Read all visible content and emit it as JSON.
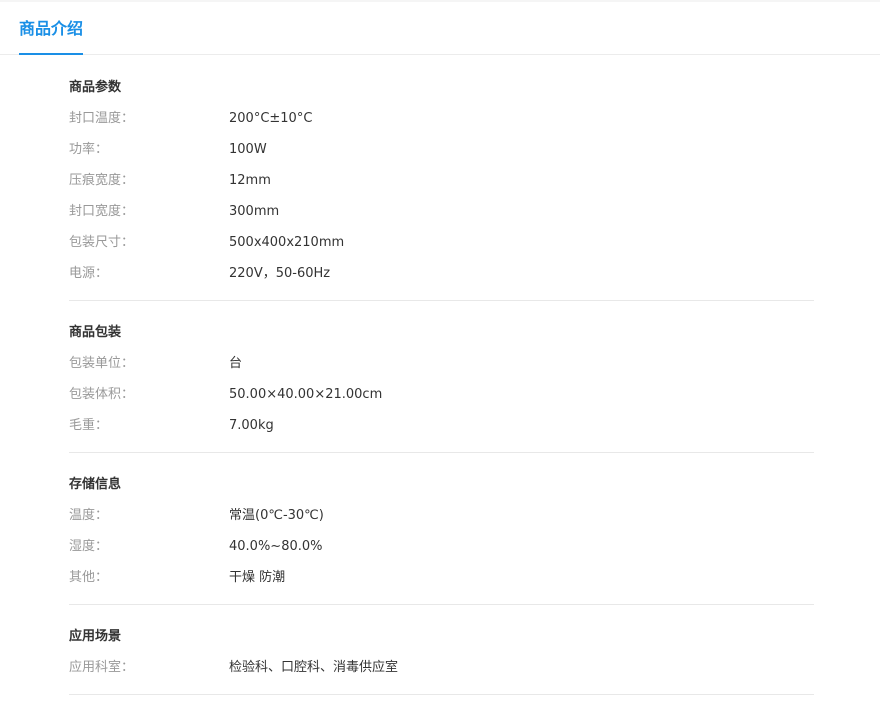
{
  "tab": {
    "label": "商品介绍"
  },
  "sections": [
    {
      "title": "商品参数",
      "rows": [
        {
          "label": "封口温度：",
          "value": "200°C±10°C"
        },
        {
          "label": "功率：",
          "value": "100W"
        },
        {
          "label": "压痕宽度：",
          "value": "12mm"
        },
        {
          "label": "封口宽度：",
          "value": "300mm"
        },
        {
          "label": "包装尺寸：",
          "value": "500x400x210mm"
        },
        {
          "label": "电源：",
          "value": "220V，50-60Hz"
        }
      ]
    },
    {
      "title": "商品包装",
      "rows": [
        {
          "label": "包装单位：",
          "value": "台"
        },
        {
          "label": "包装体积：",
          "value": "50.00×40.00×21.00cm"
        },
        {
          "label": "毛重：",
          "value": "7.00kg"
        }
      ]
    },
    {
      "title": "存储信息",
      "rows": [
        {
          "label": "温度：",
          "value": "常温(0℃-30℃)"
        },
        {
          "label": "湿度：",
          "value": "40.0%~80.0%"
        },
        {
          "label": "其他：",
          "value": "干燥 防潮"
        }
      ]
    },
    {
      "title": "应用场景",
      "rows": [
        {
          "label": "应用科室：",
          "value": "检验科、口腔科、消毒供应室"
        }
      ]
    }
  ]
}
